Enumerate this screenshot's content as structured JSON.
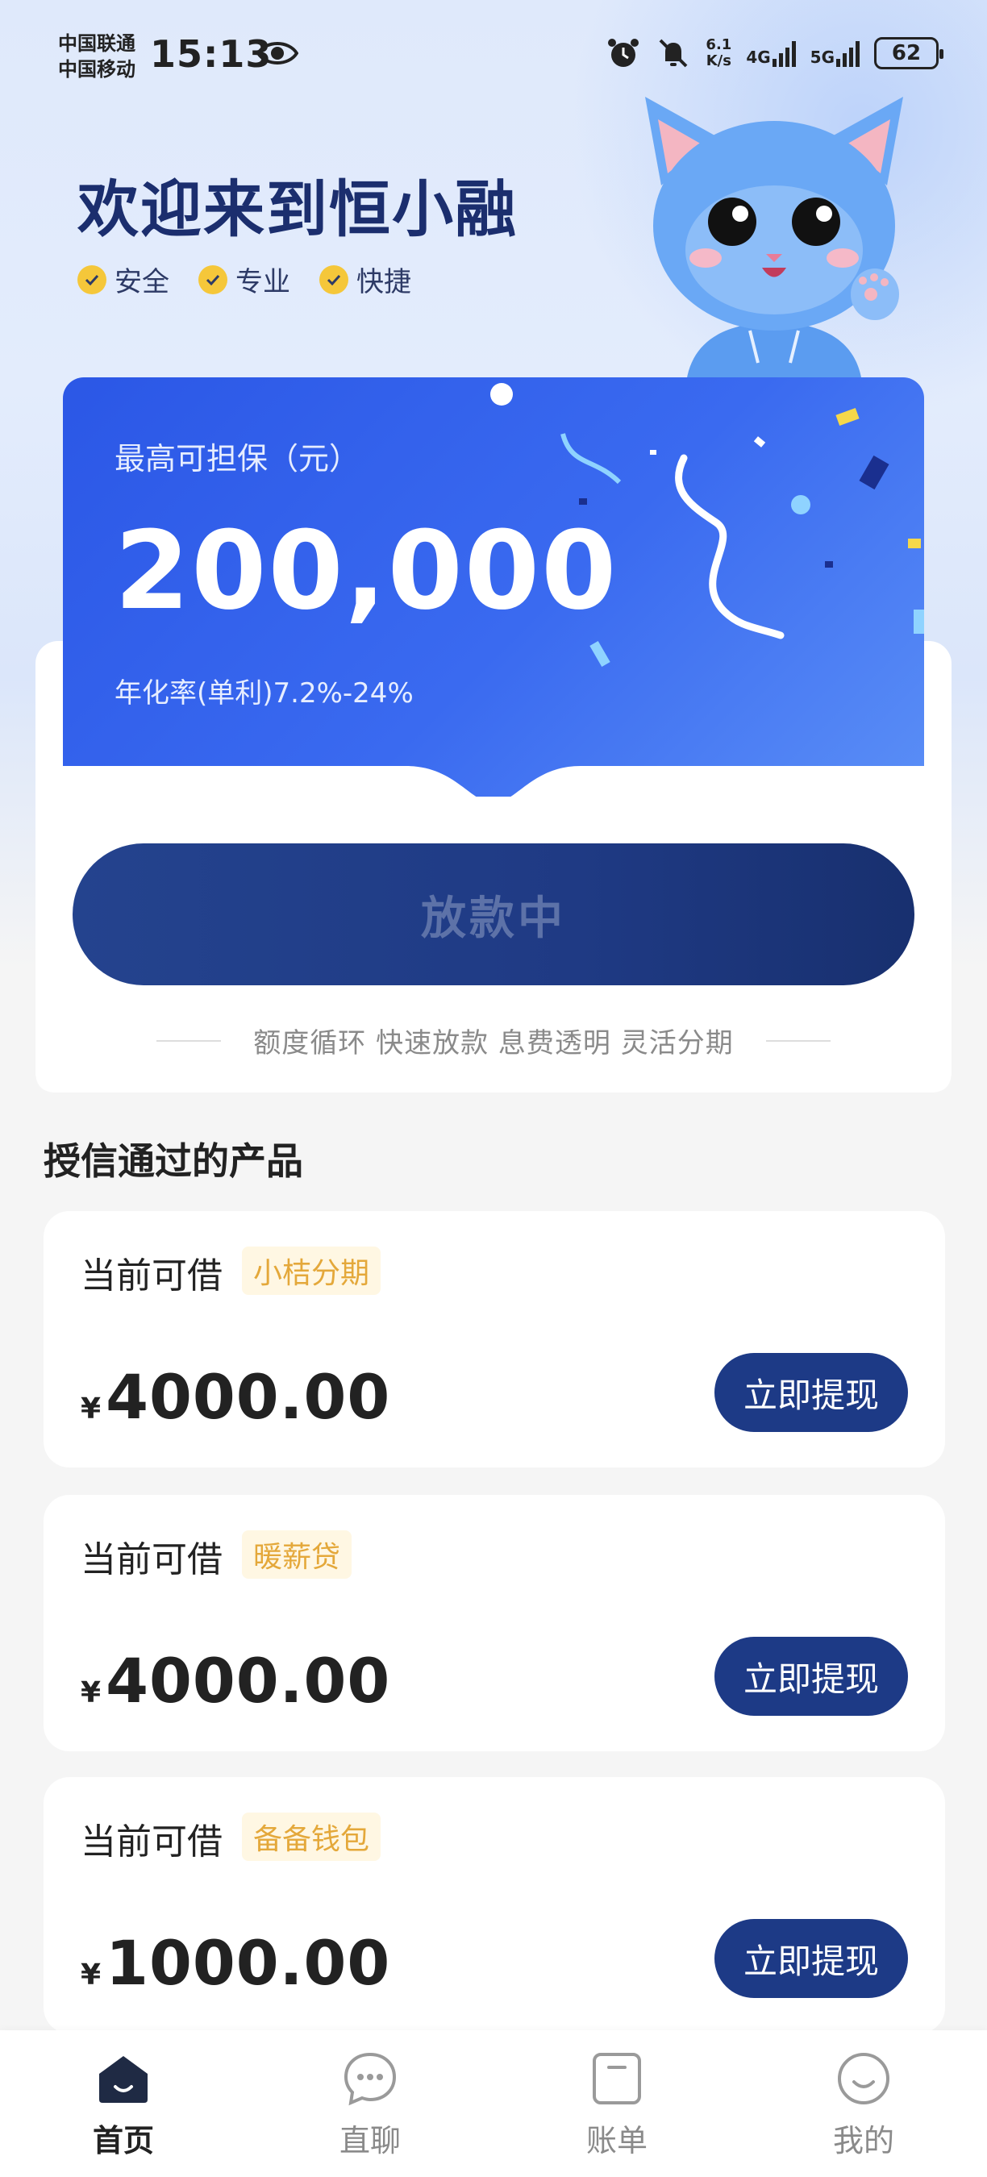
{
  "status_bar": {
    "carrier_1": "中国联通",
    "carrier_2": "中国移动",
    "time": "15:13",
    "speed_value": "6.1",
    "speed_unit": "K/s",
    "network_1": "4G",
    "network_2": "5G",
    "battery": "62"
  },
  "header": {
    "title": "欢迎来到恒小融",
    "features": [
      "安全",
      "专业",
      "快捷"
    ]
  },
  "credit_card": {
    "label": "最高可担保（元）",
    "amount": "200,000",
    "rate": "年化率(单利)7.2%-24%"
  },
  "loan_panel": {
    "button_label": "放款中",
    "tagline": "额度循环 快速放款 息费透明 灵活分期"
  },
  "products_section": {
    "title": "授信通过的产品",
    "items": [
      {
        "label": "当前可借",
        "tag": "小桔分期",
        "currency": "¥",
        "amount": "4000.00",
        "button": "立即提现"
      },
      {
        "label": "当前可借",
        "tag": "暖薪贷",
        "currency": "¥",
        "amount": "4000.00",
        "button": "立即提现"
      },
      {
        "label": "当前可借",
        "tag": "备备钱包",
        "currency": "¥",
        "amount": "1000.00",
        "button": "立即提现"
      }
    ]
  },
  "bottom_nav": {
    "items": [
      {
        "label": "首页",
        "icon": "home-icon",
        "active": true
      },
      {
        "label": "直聊",
        "icon": "chat-icon",
        "active": false
      },
      {
        "label": "账单",
        "icon": "bill-icon",
        "active": false
      },
      {
        "label": "我的",
        "icon": "profile-icon",
        "active": false
      }
    ]
  },
  "colors": {
    "brand_dark": "#1d3a86",
    "card_blue": "#2b57e6",
    "tag_orange": "#e4a83a",
    "check_yellow": "#f5c73a"
  }
}
